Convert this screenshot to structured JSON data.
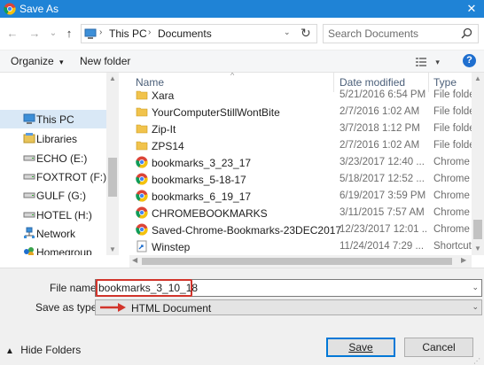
{
  "window": {
    "title": "Save As",
    "close_glyph": "✕",
    "app_icon": "chrome-icon"
  },
  "nav": {
    "back_glyph": "←",
    "forward_glyph": "→",
    "recent_glyph": "⌄",
    "up_glyph": "↑",
    "breadcrumb": [
      "This PC",
      "Documents"
    ],
    "crumb_sep": "›",
    "dropdown_glyph": "⌄",
    "refresh_glyph": "↻",
    "search_placeholder": "Search Documents"
  },
  "toolbar": {
    "organize": "Organize",
    "organize_caret": "▾",
    "new_folder": "New folder",
    "views_caret": "▾",
    "help": "?"
  },
  "sidebar": {
    "items": [
      {
        "label": "This PC",
        "icon": "computer-icon",
        "selected": true
      },
      {
        "label": "Libraries",
        "icon": "libraries-icon"
      },
      {
        "label": "ECHO (E:)",
        "icon": "drive-icon"
      },
      {
        "label": "FOXTROT (F:)",
        "icon": "drive-icon"
      },
      {
        "label": "GULF (G:)",
        "icon": "drive-icon"
      },
      {
        "label": "HOTEL (H:)",
        "icon": "drive-icon"
      },
      {
        "label": "Network",
        "icon": "network-icon"
      },
      {
        "label": "Homegroup",
        "icon": "homegroup-icon"
      }
    ]
  },
  "columns": {
    "name": "Name",
    "date": "Date modified",
    "type": "Type"
  },
  "files": [
    {
      "name": "Xara",
      "date": "5/21/2016 6:54 PM",
      "type": "File folder",
      "icon": "folder-icon"
    },
    {
      "name": "YourComputerStillWontBite",
      "date": "2/7/2016 1:02 AM",
      "type": "File folder",
      "icon": "folder-icon"
    },
    {
      "name": "Zip-It",
      "date": "3/7/2018 1:12 PM",
      "type": "File folder",
      "icon": "folder-icon"
    },
    {
      "name": "ZPS14",
      "date": "2/7/2016 1:02 AM",
      "type": "File folder",
      "icon": "folder-icon"
    },
    {
      "name": "bookmarks_3_23_17",
      "date": "3/23/2017 12:40 ...",
      "type": "Chrome H",
      "icon": "chrome-icon"
    },
    {
      "name": "bookmarks_5-18-17",
      "date": "5/18/2017 12:52 ...",
      "type": "Chrome H",
      "icon": "chrome-icon"
    },
    {
      "name": "bookmarks_6_19_17",
      "date": "6/19/2017 3:59 PM",
      "type": "Chrome H",
      "icon": "chrome-icon"
    },
    {
      "name": "CHROMEBOOKMARKS",
      "date": "3/11/2015 7:57 AM",
      "type": "Chrome H",
      "icon": "chrome-icon"
    },
    {
      "name": "Saved-Chrome-Bookmarks-23DEC2017",
      "date": "12/23/2017 12:01 ...",
      "type": "Chrome H",
      "icon": "chrome-icon"
    },
    {
      "name": "Winstep",
      "date": "11/24/2014 7:29 ...",
      "type": "Shortcut",
      "icon": "shortcut-icon"
    }
  ],
  "form": {
    "filename_label": "File name:",
    "filename_value": "bookmarks_3_10_18",
    "savetype_label": "Save as type:",
    "savetype_value": "HTML Document"
  },
  "footer": {
    "hide_folders": "Hide Folders",
    "hide_caret": "▲",
    "save": "Save",
    "cancel": "Cancel"
  },
  "colors": {
    "titlebar": "#1f83d6",
    "highlight": "#d2342b",
    "selected": "#d9e8f6"
  }
}
